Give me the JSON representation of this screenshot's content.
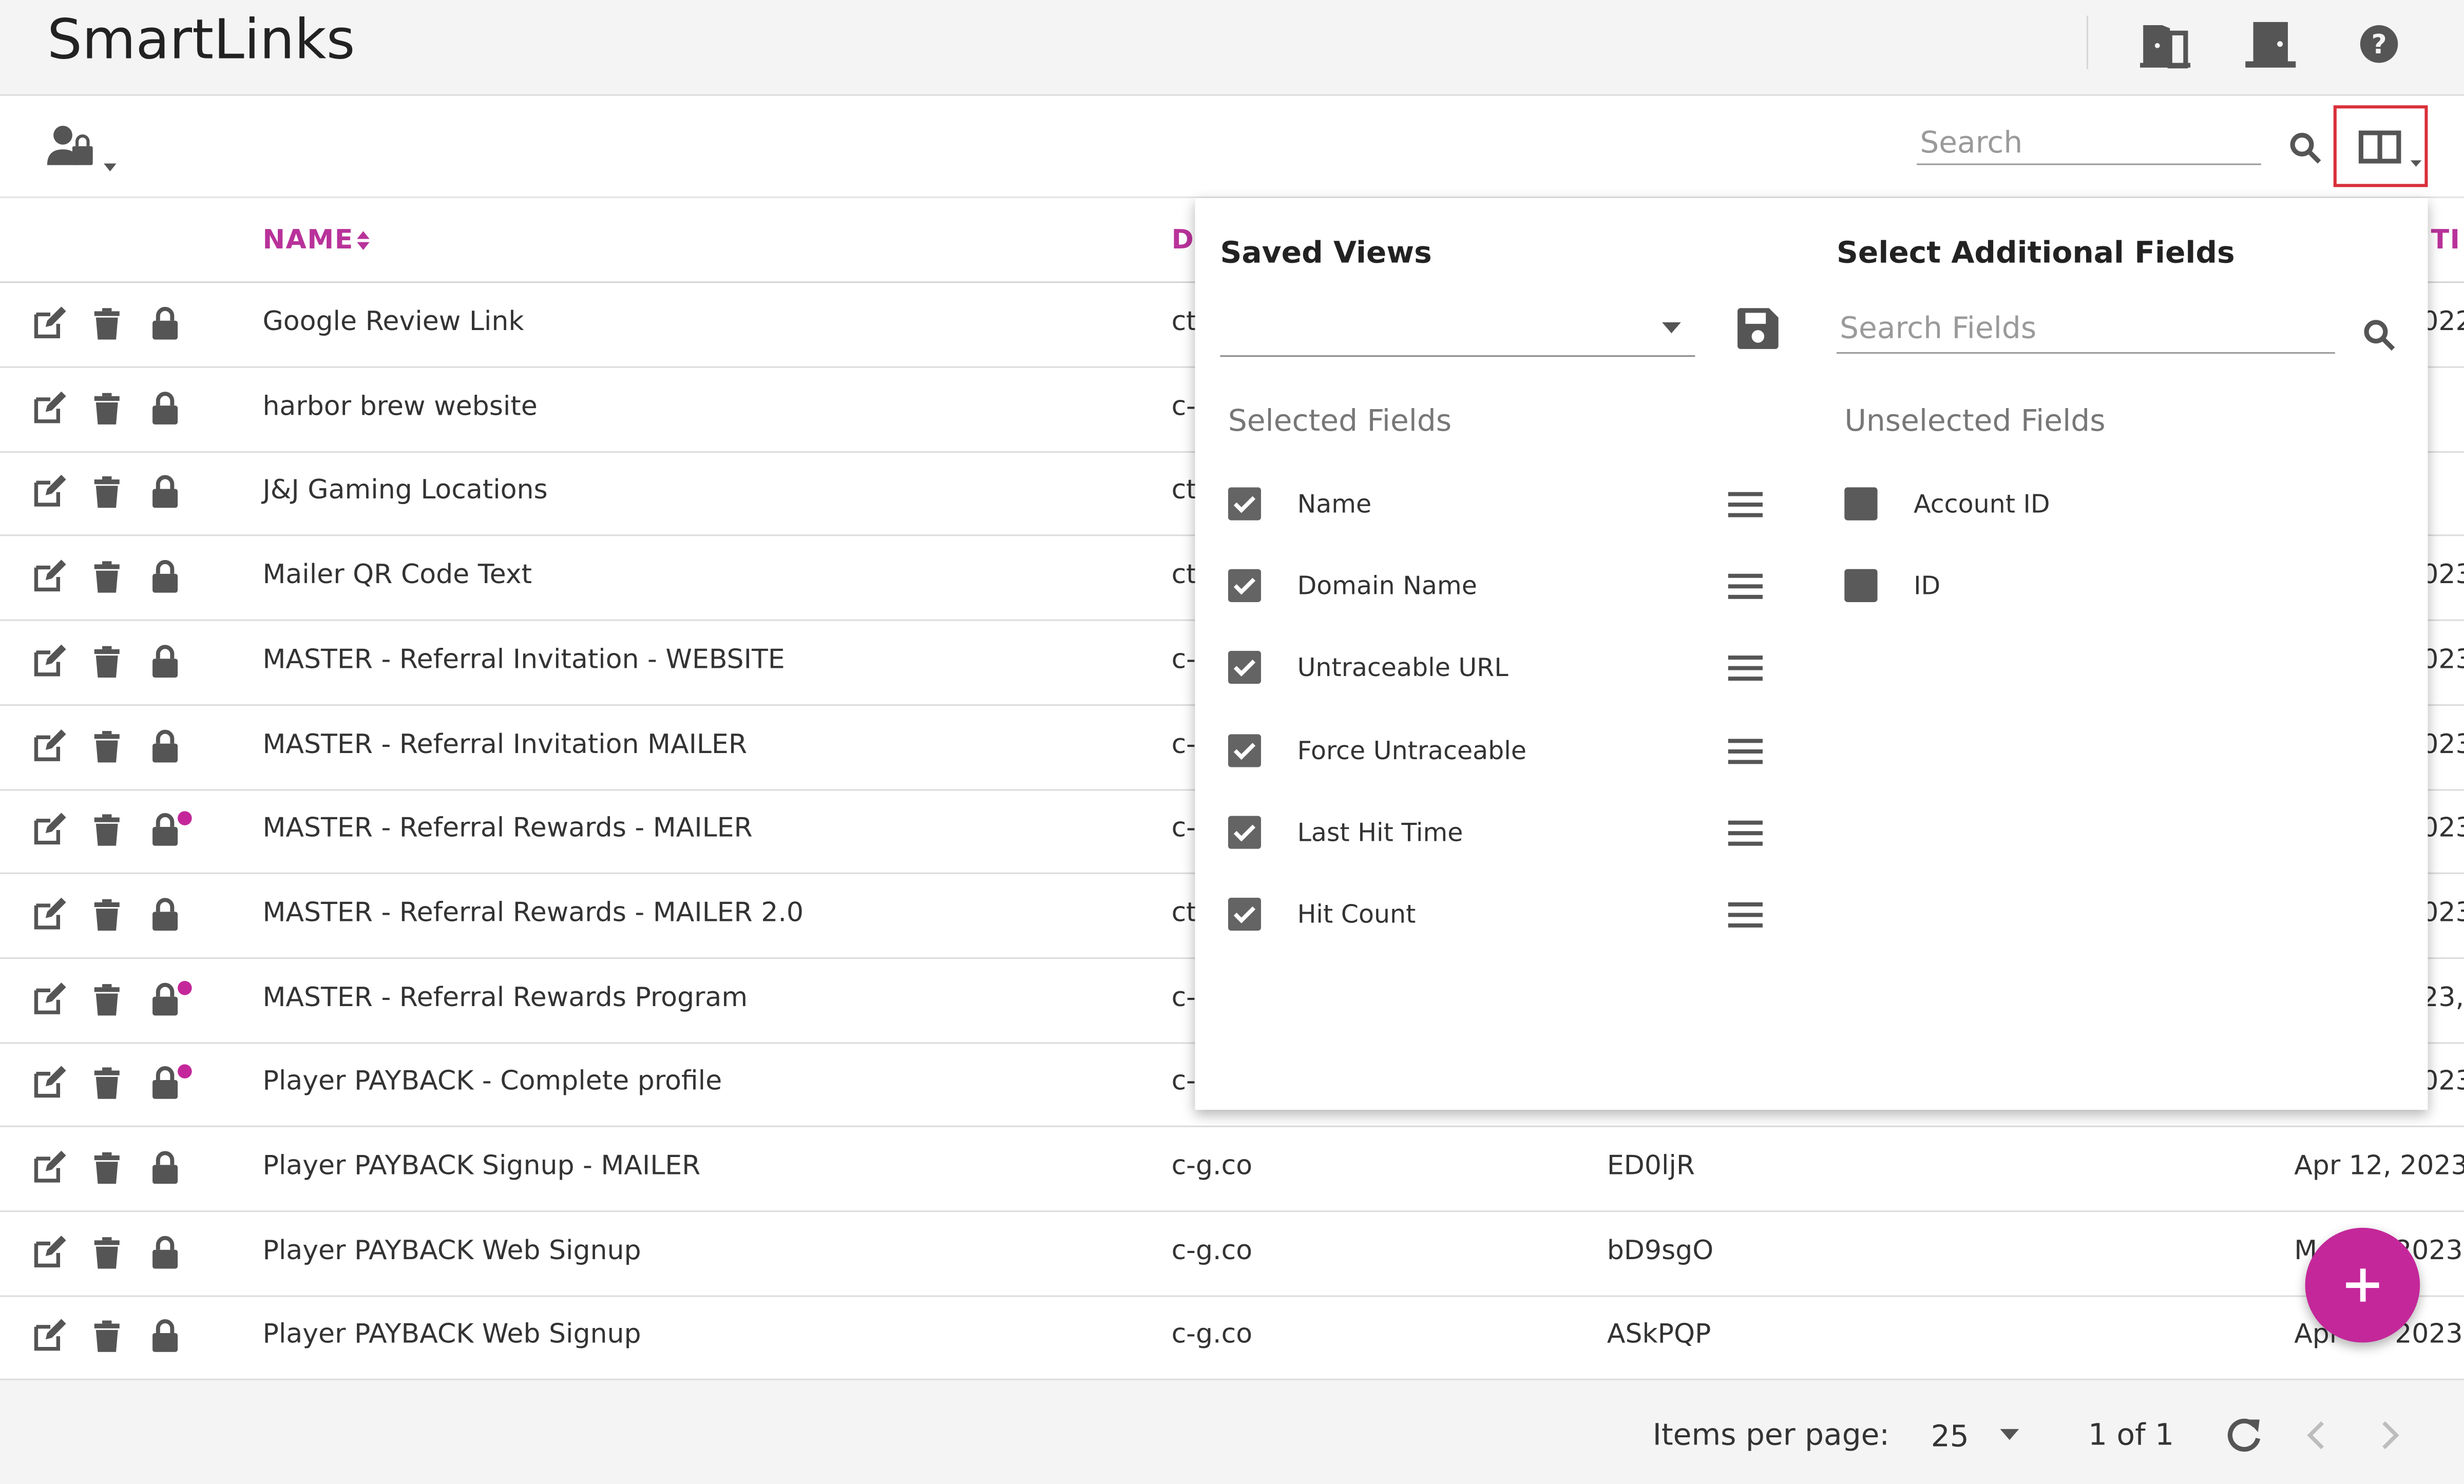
{
  "app": {
    "title": "SmartLinks"
  },
  "header": {
    "icons": [
      "exit-door-icon",
      "door-icon",
      "help-icon"
    ]
  },
  "toolbar": {
    "search": {
      "placeholder": "Search"
    },
    "icons": [
      "user-lock-icon",
      "search-icon",
      "columns-icon"
    ]
  },
  "table": {
    "columns": [
      {
        "label": "NAME",
        "sort": "sort-icon"
      },
      {
        "label": "D"
      },
      {
        "label": "TI"
      }
    ],
    "rows": [
      {
        "name": "Google Review Link",
        "domain": "ct",
        "code": "",
        "date": "022",
        "alert": false
      },
      {
        "name": "harbor brew website",
        "domain": "c-",
        "code": "",
        "date": "",
        "alert": false
      },
      {
        "name": "J&J Gaming Locations",
        "domain": "ct",
        "code": "",
        "date": "",
        "alert": false
      },
      {
        "name": "Mailer QR Code Text",
        "domain": "ct",
        "code": "",
        "date": "023",
        "alert": false
      },
      {
        "name": "MASTER - Referral Invitation - WEBSITE",
        "domain": "c-",
        "code": "",
        "date": "023",
        "alert": false
      },
      {
        "name": "MASTER - Referral Invitation MAILER",
        "domain": "c-",
        "code": "",
        "date": "023",
        "alert": false
      },
      {
        "name": "MASTER - Referral Rewards - MAILER",
        "domain": "c-",
        "code": "",
        "date": "023",
        "alert": true
      },
      {
        "name": "MASTER - Referral Rewards - MAILER 2.0",
        "domain": "ct",
        "code": "",
        "date": "023",
        "alert": false
      },
      {
        "name": "MASTER - Referral Rewards Program",
        "domain": "c-",
        "code": "",
        "date": "23,",
        "alert": true
      },
      {
        "name": "Player PAYBACK - Complete profile",
        "domain": "c-",
        "code": "",
        "date": "023",
        "alert": true
      },
      {
        "name": "Player PAYBACK Signup - MAILER",
        "domain": "c-g.co",
        "code": "ED0ljR",
        "date": "Apr 12, 2023",
        "alert": false
      },
      {
        "name": "Player PAYBACK Web Signup",
        "domain": "c-g.co",
        "code": "bD9sgO",
        "date": "M",
        "date2": "2023",
        "alert": false
      },
      {
        "name": "Player PAYBACK Web Signup",
        "domain": "c-g.co",
        "code": "ASkPQP",
        "date": "Apr",
        "date2": "2023",
        "alert": false
      }
    ]
  },
  "panel": {
    "saved_views_title": "Saved Views",
    "additional_title": "Select Additional Fields",
    "search_fields_placeholder": "Search Fields",
    "selected_title": "Selected Fields",
    "unselected_title": "Unselected Fields",
    "selected_fields": [
      "Name",
      "Domain Name",
      "Untraceable URL",
      "Force Untraceable",
      "Last Hit Time",
      "Hit Count"
    ],
    "unselected_fields": [
      "Account ID",
      "ID"
    ]
  },
  "footer": {
    "items_per_page_label": "Items per page:",
    "items_per_page_value": "25",
    "range": "1 of 1"
  },
  "colors": {
    "accent": "#c4279a",
    "highlight_border": "#d9303a"
  }
}
